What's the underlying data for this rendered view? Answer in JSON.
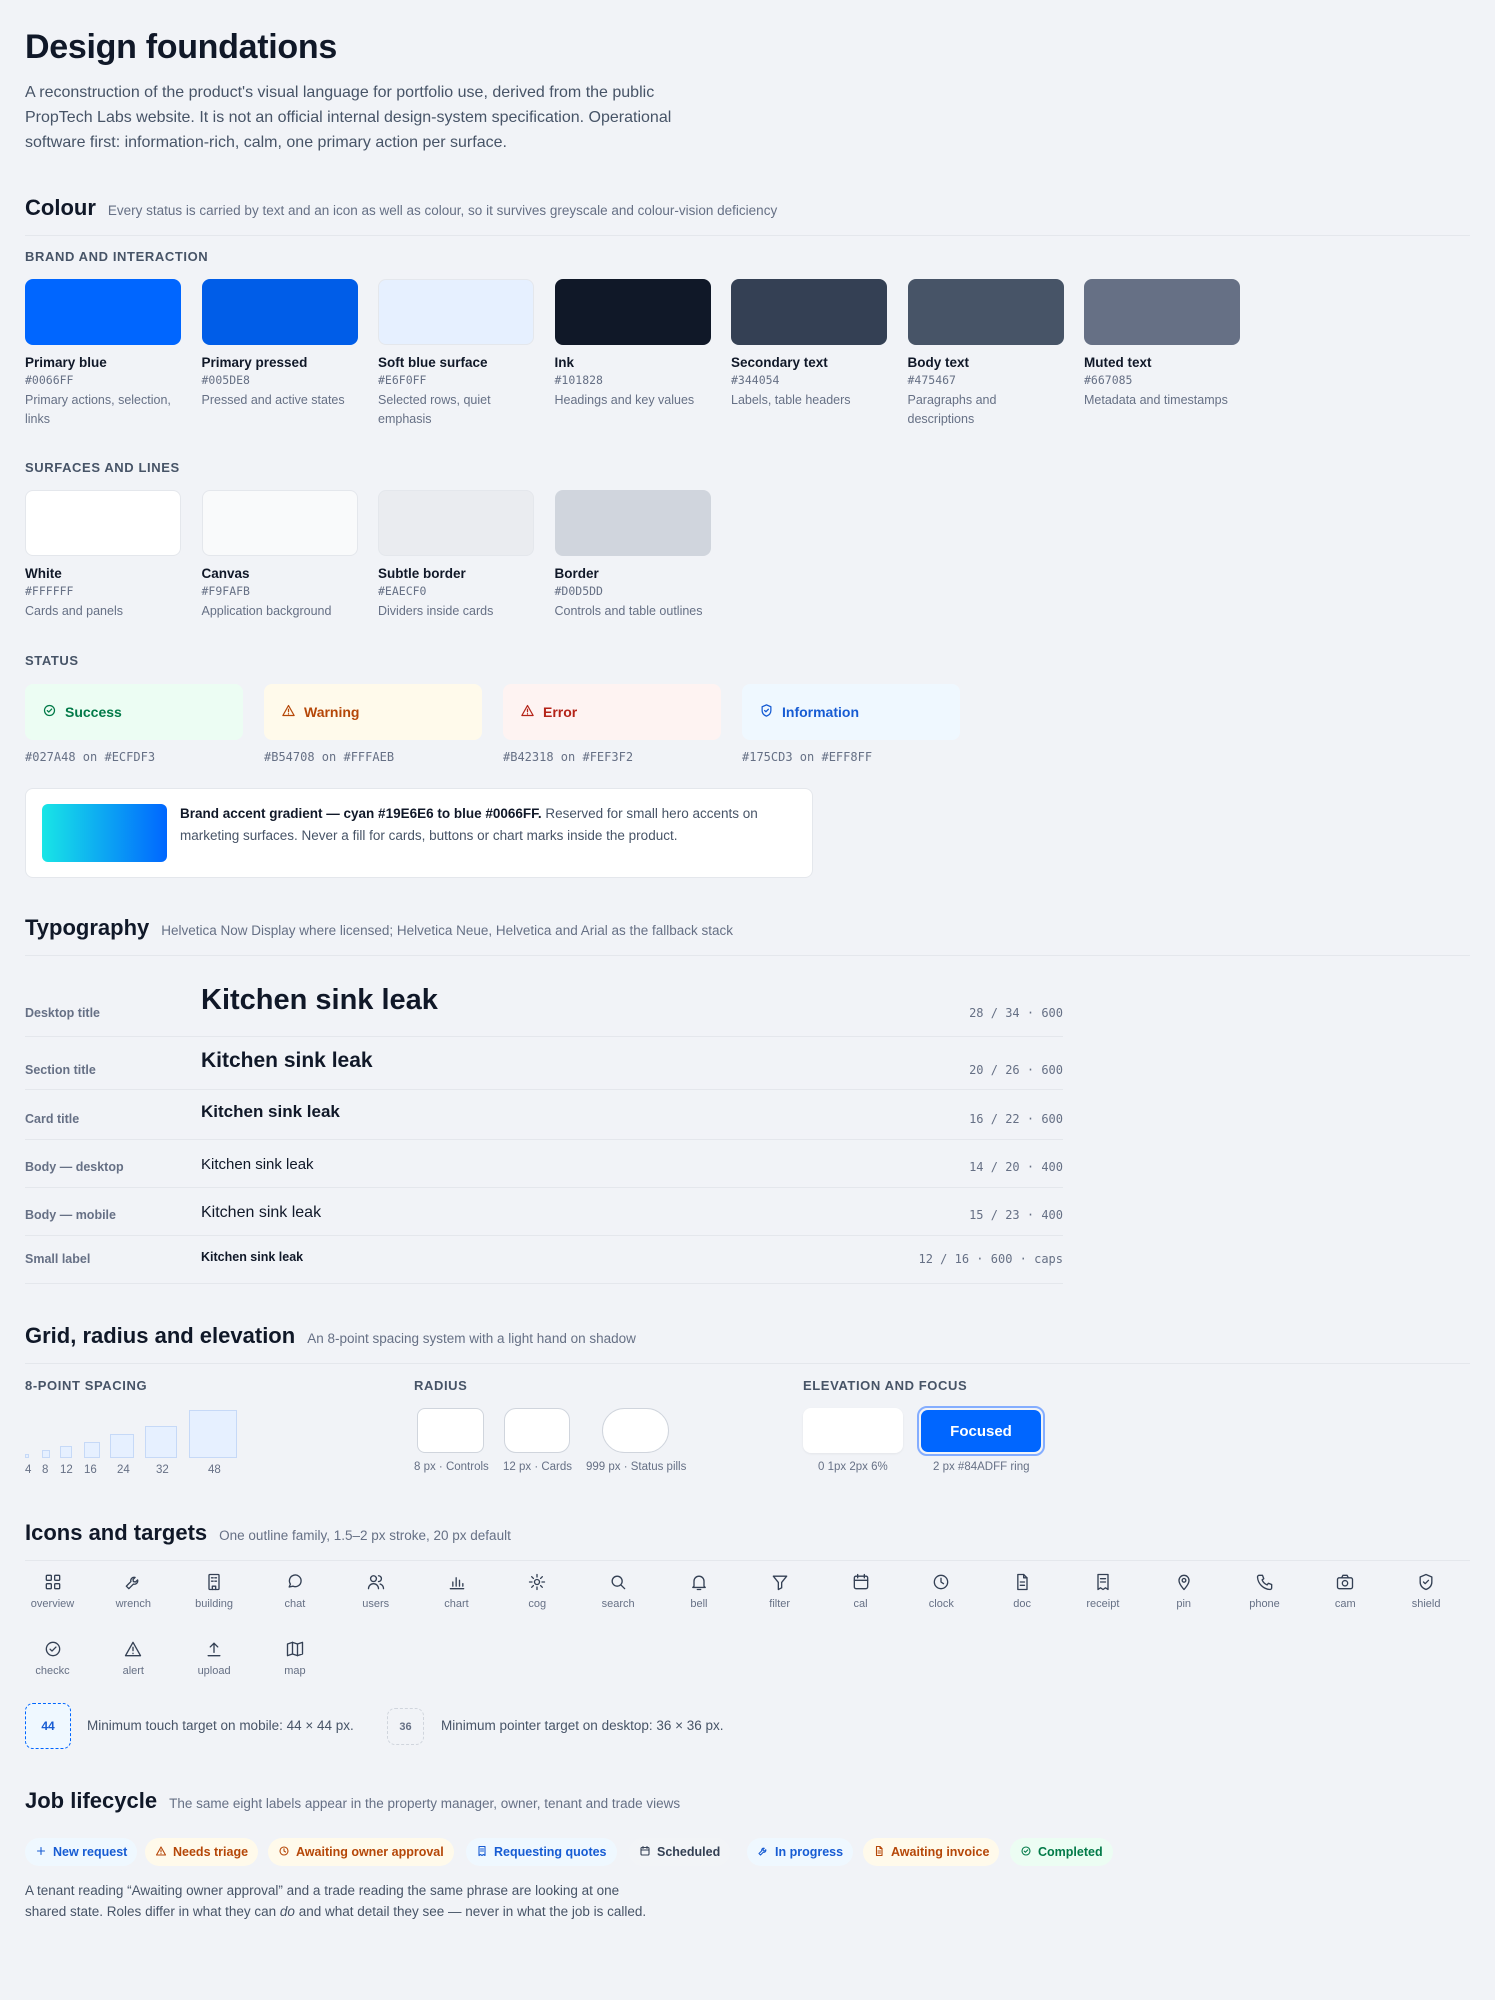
{
  "title": "Design foundations",
  "intro": "A reconstruction of the product's visual language for portfolio use, derived from the public PropTech Labs website. It is not an official internal design-system specification. Operational software first: information-rich, calm, one primary action per surface.",
  "colour": {
    "title": "Colour",
    "desc": "Every status is carried by text and an icon as well as colour, so it survives greyscale and colour-vision deficiency",
    "brand_heading": "BRAND AND INTERACTION",
    "brand": [
      {
        "name": "Primary blue",
        "hex": "#0066FF",
        "desc": "Primary actions, selection, links",
        "color": "#0066FF"
      },
      {
        "name": "Primary pressed",
        "hex": "#005DE8",
        "desc": "Pressed and active states",
        "color": "#005DE8"
      },
      {
        "name": "Soft blue surface",
        "hex": "#E6F0FF",
        "desc": "Selected rows, quiet emphasis",
        "color": "#E6F0FF"
      },
      {
        "name": "Ink",
        "hex": "#101828",
        "desc": "Headings and key values",
        "color": "#101828"
      },
      {
        "name": "Secondary text",
        "hex": "#344054",
        "desc": "Labels, table headers",
        "color": "#344054"
      },
      {
        "name": "Body text",
        "hex": "#475467",
        "desc": "Paragraphs and descriptions",
        "color": "#475467"
      },
      {
        "name": "Muted text",
        "hex": "#667085",
        "desc": "Metadata and timestamps",
        "color": "#667085"
      }
    ],
    "surfaces_heading": "SURFACES AND LINES",
    "surfaces": [
      {
        "name": "White",
        "hex": "#FFFFFF",
        "desc": "Cards and panels",
        "color": "#FFFFFF"
      },
      {
        "name": "Canvas",
        "hex": "#F9FAFB",
        "desc": "Application background",
        "color": "#F9FAFB"
      },
      {
        "name": "Subtle border",
        "hex": "#EAECF0",
        "desc": "Dividers inside cards",
        "color": "#EAECF0"
      },
      {
        "name": "Border",
        "hex": "#D0D5DD",
        "desc": "Controls and table outlines",
        "color": "#D0D5DD"
      }
    ],
    "status_heading": "STATUS",
    "status": [
      {
        "label": "Success",
        "code": "#027A48 on #ECFDF3",
        "fg": "#027A48",
        "bg": "#ECFDF3",
        "icon": "check-circle-icon"
      },
      {
        "label": "Warning",
        "code": "#B54708 on #FFFAEB",
        "fg": "#B54708",
        "bg": "#FFFAEB",
        "icon": "warning-icon"
      },
      {
        "label": "Error",
        "code": "#B42318 on #FEF3F2",
        "fg": "#B42318",
        "bg": "#FEF3F2",
        "icon": "alert-icon"
      },
      {
        "label": "Information",
        "code": "#175CD3 on #EFF8FF",
        "fg": "#175CD3",
        "bg": "#EFF8FF",
        "icon": "shield-icon"
      }
    ],
    "gradient_title": "Brand accent gradient — cyan #19E6E6 to blue #0066FF.",
    "gradient_desc": " Reserved for small hero accents on marketing surfaces. Never a fill for cards, buttons or chart marks inside the product."
  },
  "typography": {
    "title": "Typography",
    "desc": "Helvetica Now Display where licensed; Helvetica Neue, Helvetica and Arial as the fallback stack",
    "sample": "Kitchen sink leak",
    "rows": [
      {
        "label": "Desktop title",
        "spec": "28 / 34 · 600"
      },
      {
        "label": "Section title",
        "spec": "20 / 26 · 600"
      },
      {
        "label": "Card title",
        "spec": "16 / 22 · 600"
      },
      {
        "label": "Body — desktop",
        "spec": "14 / 20 · 400"
      },
      {
        "label": "Body — mobile",
        "spec": "15 / 23 · 400"
      },
      {
        "label": "Small label",
        "spec": "12 / 16 · 600 · caps"
      }
    ]
  },
  "grid": {
    "title": "Grid, radius and elevation",
    "desc": "An 8-point spacing system with a light hand on shadow",
    "spacing_heading": "8-POINT SPACING",
    "spacing": [
      "4",
      "8",
      "12",
      "16",
      "24",
      "32",
      "48"
    ],
    "radius_heading": "RADIUS",
    "radius": [
      "8 px · Controls",
      "12 px · Cards",
      "999 px · Status pills"
    ],
    "elevation_heading": "ELEVATION AND FOCUS",
    "focused_label": "Focused",
    "elevation_caption": "0 1px 2px 6%",
    "focus_caption": "2 px #84ADFF ring"
  },
  "icons": {
    "title": "Icons and targets",
    "desc": "One outline family, 1.5–2 px stroke, 20 px default",
    "items": [
      "overview",
      "wrench",
      "building",
      "chat",
      "users",
      "chart",
      "cog",
      "search",
      "bell",
      "filter",
      "cal",
      "clock",
      "doc",
      "receipt",
      "pin",
      "phone",
      "cam",
      "shield",
      "checkc",
      "alert",
      "upload",
      "map"
    ],
    "touch_value": "44",
    "touch_text": "Minimum touch target on mobile: 44 × 44 px.",
    "pointer_value": "36",
    "pointer_text": "Minimum pointer target on desktop: 36 × 36 px."
  },
  "lifecycle": {
    "title": "Job lifecycle",
    "desc": "The same eight labels appear in the property manager, owner, tenant and trade views",
    "chips": [
      {
        "label": "New request",
        "fg": "#175CD3",
        "bg": "#EFF8FF",
        "icon": "plus-icon"
      },
      {
        "label": "Needs triage",
        "fg": "#B54708",
        "bg": "#FFFAEB",
        "icon": "warning-icon"
      },
      {
        "label": "Awaiting owner approval",
        "fg": "#B54708",
        "bg": "#FFFAEB",
        "icon": "clock-icon"
      },
      {
        "label": "Requesting quotes",
        "fg": "#175CD3",
        "bg": "#EFF8FF",
        "icon": "receipt-icon"
      },
      {
        "label": "Scheduled",
        "fg": "#344054",
        "bg": "#F2F4F7",
        "icon": "calendar-icon"
      },
      {
        "label": "In progress",
        "fg": "#175CD3",
        "bg": "#EFF8FF",
        "icon": "wrench-icon"
      },
      {
        "label": "Awaiting invoice",
        "fg": "#B54708",
        "bg": "#FFFAEB",
        "icon": "doc-icon"
      },
      {
        "label": "Completed",
        "fg": "#027A48",
        "bg": "#ECFDF3",
        "icon": "check-circle-icon"
      }
    ],
    "note_a": "A tenant reading “Awaiting owner approval” and a trade reading the same phrase are looking at one shared state. Roles differ in what they can ",
    "note_em": "do",
    "note_b": " and what detail they see — never in what the job is called."
  }
}
